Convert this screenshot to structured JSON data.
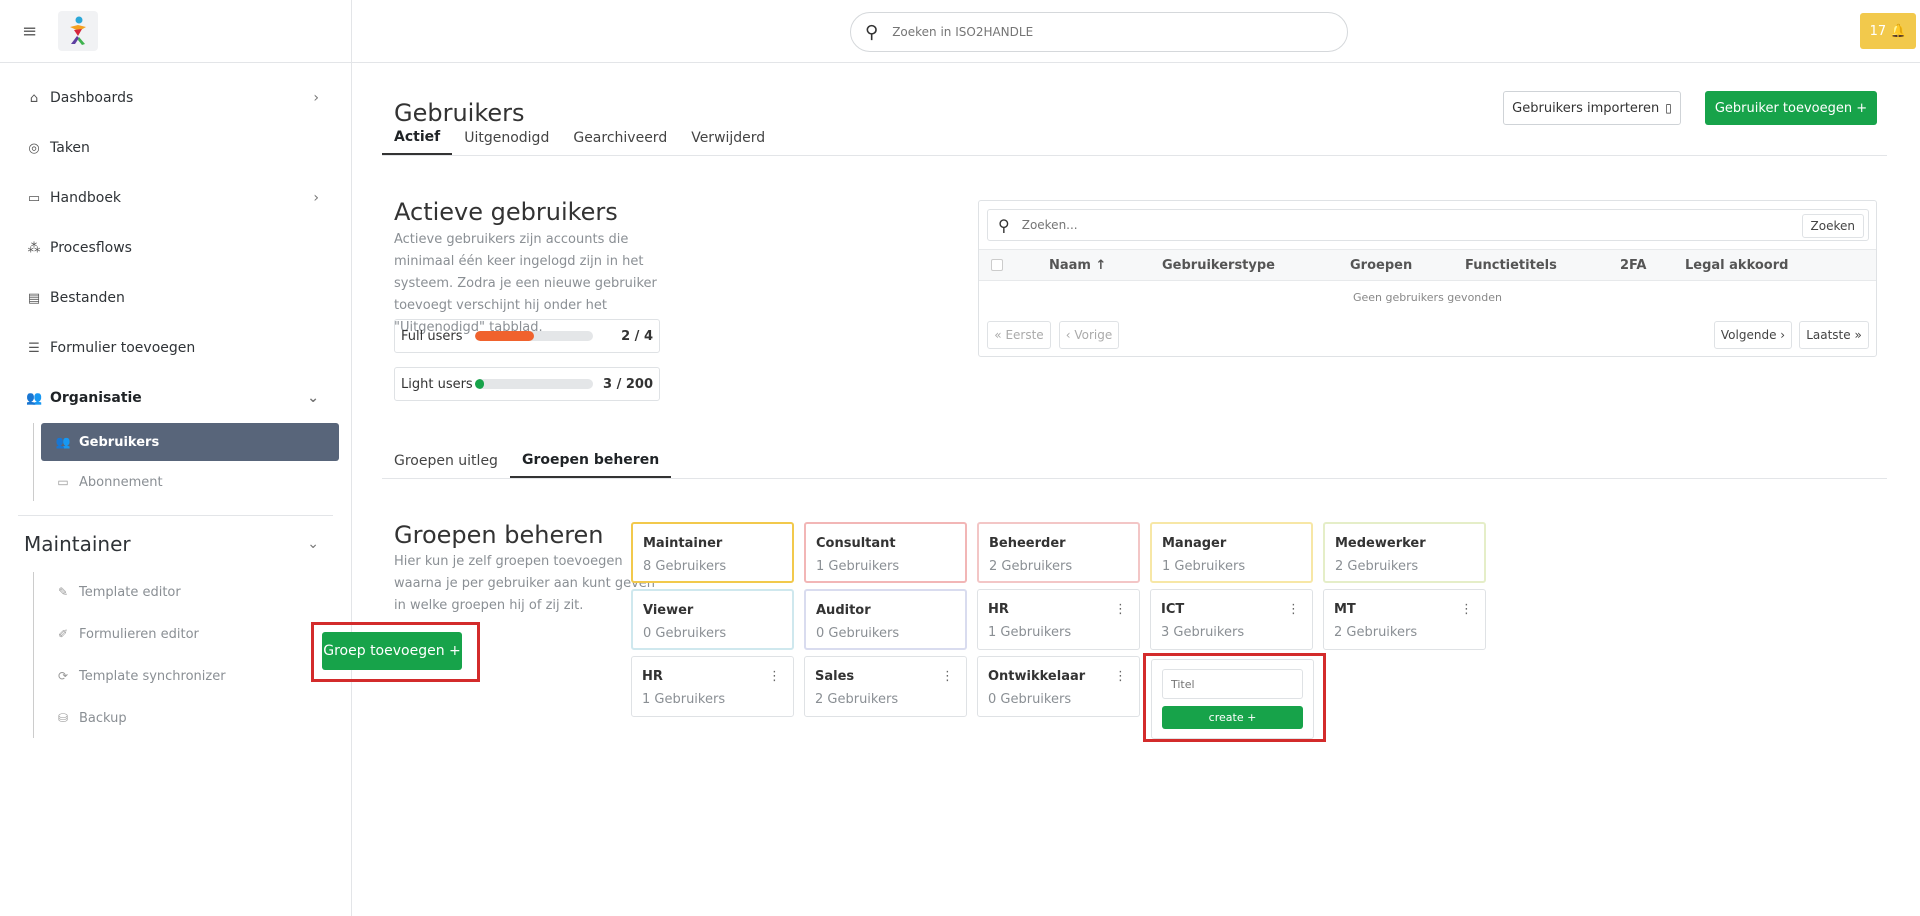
{
  "topbar": {
    "search_placeholder": "Zoeken in ISO2HANDLE",
    "notifications": "17 🔔"
  },
  "sidebar": {
    "items": [
      {
        "label": "Dashboards",
        "icon": "home-icon"
      },
      {
        "label": "Taken",
        "icon": "check-circle-icon"
      },
      {
        "label": "Handboek",
        "icon": "book-icon"
      },
      {
        "label": "Procesflows",
        "icon": "flow-icon"
      },
      {
        "label": "Bestanden",
        "icon": "folder-icon"
      },
      {
        "label": "Formulier toevoegen",
        "icon": "form-icon"
      },
      {
        "label": "Organisatie",
        "icon": "users-icon"
      }
    ],
    "org_sub": [
      {
        "label": "Gebruikers"
      },
      {
        "label": "Abonnement"
      }
    ],
    "maintainer_title": "Maintainer",
    "maintainer_sub": [
      {
        "label": "Template editor"
      },
      {
        "label": "Formulieren editor"
      },
      {
        "label": "Template synchronizer"
      },
      {
        "label": "Backup"
      }
    ]
  },
  "page": {
    "title": "Gebruikers",
    "import_label": "Gebruikers importeren",
    "add_label": "Gebruiker toevoegen +",
    "tabs": [
      "Actief",
      "Uitgenodigd",
      "Gearchiveerd",
      "Verwijderd"
    ]
  },
  "active": {
    "title": "Actieve gebruikers",
    "description": "Actieve gebruikers zijn accounts die minimaal één keer ingelogd zijn in het systeem. Zodra je een nieuwe gebruiker toevoegt verschijnt hij onder het \"Uitgenodigd\" tabblad.",
    "full": {
      "label": "Full users",
      "count": "2 / 4",
      "fraction": 0.5,
      "color": "#f0622d"
    },
    "light": {
      "label": "Light users",
      "count": "3 / 200",
      "fraction": 0.015,
      "color": "#17a34a"
    }
  },
  "table": {
    "search_placeholder": "Zoeken...",
    "search_button": "Zoeken",
    "columns": [
      "Naam ↑",
      "Gebruikerstype",
      "Groepen",
      "Functietitels",
      "2FA",
      "Legal akkoord"
    ],
    "empty": "Geen gebruikers gevonden",
    "first": "« Eerste",
    "prev": "‹ Vorige",
    "next": "Volgende ›",
    "last": "Laatste »"
  },
  "group_tabs": [
    "Groepen uitleg",
    "Groepen beheren"
  ],
  "groups_section": {
    "title": "Groepen beheren",
    "description": "Hier kun je zelf groepen toevoegen waarna je per gebruiker aan kunt geven in welke groepen hij of zij zit.",
    "add_button": "Groep toevoegen +",
    "new_placeholder": "Titel",
    "create_button": "create +"
  },
  "groups": [
    {
      "name": "Maintainer",
      "count": "8 Gebruikers",
      "border": "#f2c94c",
      "menu": false
    },
    {
      "name": "Consultant",
      "count": "1 Gebruikers",
      "border": "#f2b6b6",
      "menu": false
    },
    {
      "name": "Beheerder",
      "count": "2 Gebruikers",
      "border": "#f3c6c6",
      "menu": false
    },
    {
      "name": "Manager",
      "count": "1 Gebruikers",
      "border": "#f7e7a6",
      "menu": false
    },
    {
      "name": "Medewerker",
      "count": "2 Gebruikers",
      "border": "#e5eec8",
      "menu": false
    },
    {
      "name": "Viewer",
      "count": "0 Gebruikers",
      "border": "#cfe8ee",
      "menu": false
    },
    {
      "name": "Auditor",
      "count": "0 Gebruikers",
      "border": "#d9dcef",
      "menu": false
    },
    {
      "name": "HR",
      "count": "1 Gebruikers",
      "border": "#dfe2e5",
      "menu": true
    },
    {
      "name": "ICT",
      "count": "3 Gebruikers",
      "border": "#dfe2e5",
      "menu": true
    },
    {
      "name": "MT",
      "count": "2 Gebruikers",
      "border": "#dfe2e5",
      "menu": true
    },
    {
      "name": "HR",
      "count": "1 Gebruikers",
      "border": "#dfe2e5",
      "menu": true
    },
    {
      "name": "Sales",
      "count": "2 Gebruikers",
      "border": "#dfe2e5",
      "menu": true
    },
    {
      "name": "Ontwikkelaar",
      "count": "0 Gebruikers",
      "border": "#dfe2e5",
      "menu": true
    }
  ]
}
